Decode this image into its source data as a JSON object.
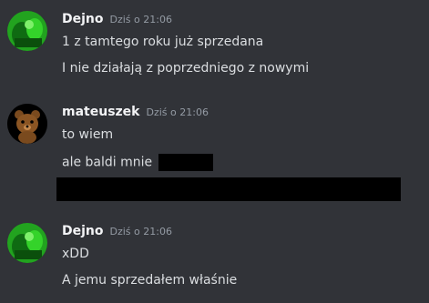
{
  "messages": [
    {
      "author": "Dejno",
      "timestamp": "Dziś o 21:06",
      "avatar_icon": "green-character-avatar-icon",
      "lines": [
        "1 z tamtego roku już sprzedana",
        "I nie działają z poprzedniego z nowymi"
      ]
    },
    {
      "author": "mateuszek",
      "timestamp": "Dziś o 21:06",
      "avatar_icon": "bear-avatar-icon",
      "lines": [
        "to wiem",
        "ale baldi mnie"
      ]
    },
    {
      "author": "Dejno",
      "timestamp": "Dziś o 21:06",
      "avatar_icon": "green-character-avatar-icon",
      "lines": [
        "xDD",
        "A jemu sprzedałem właśnie"
      ]
    }
  ],
  "colors": {
    "background": "#313338",
    "author": "#f2f3f5",
    "timestamp": "#949ba4",
    "text": "#dbdee1",
    "redaction": "#000000"
  }
}
